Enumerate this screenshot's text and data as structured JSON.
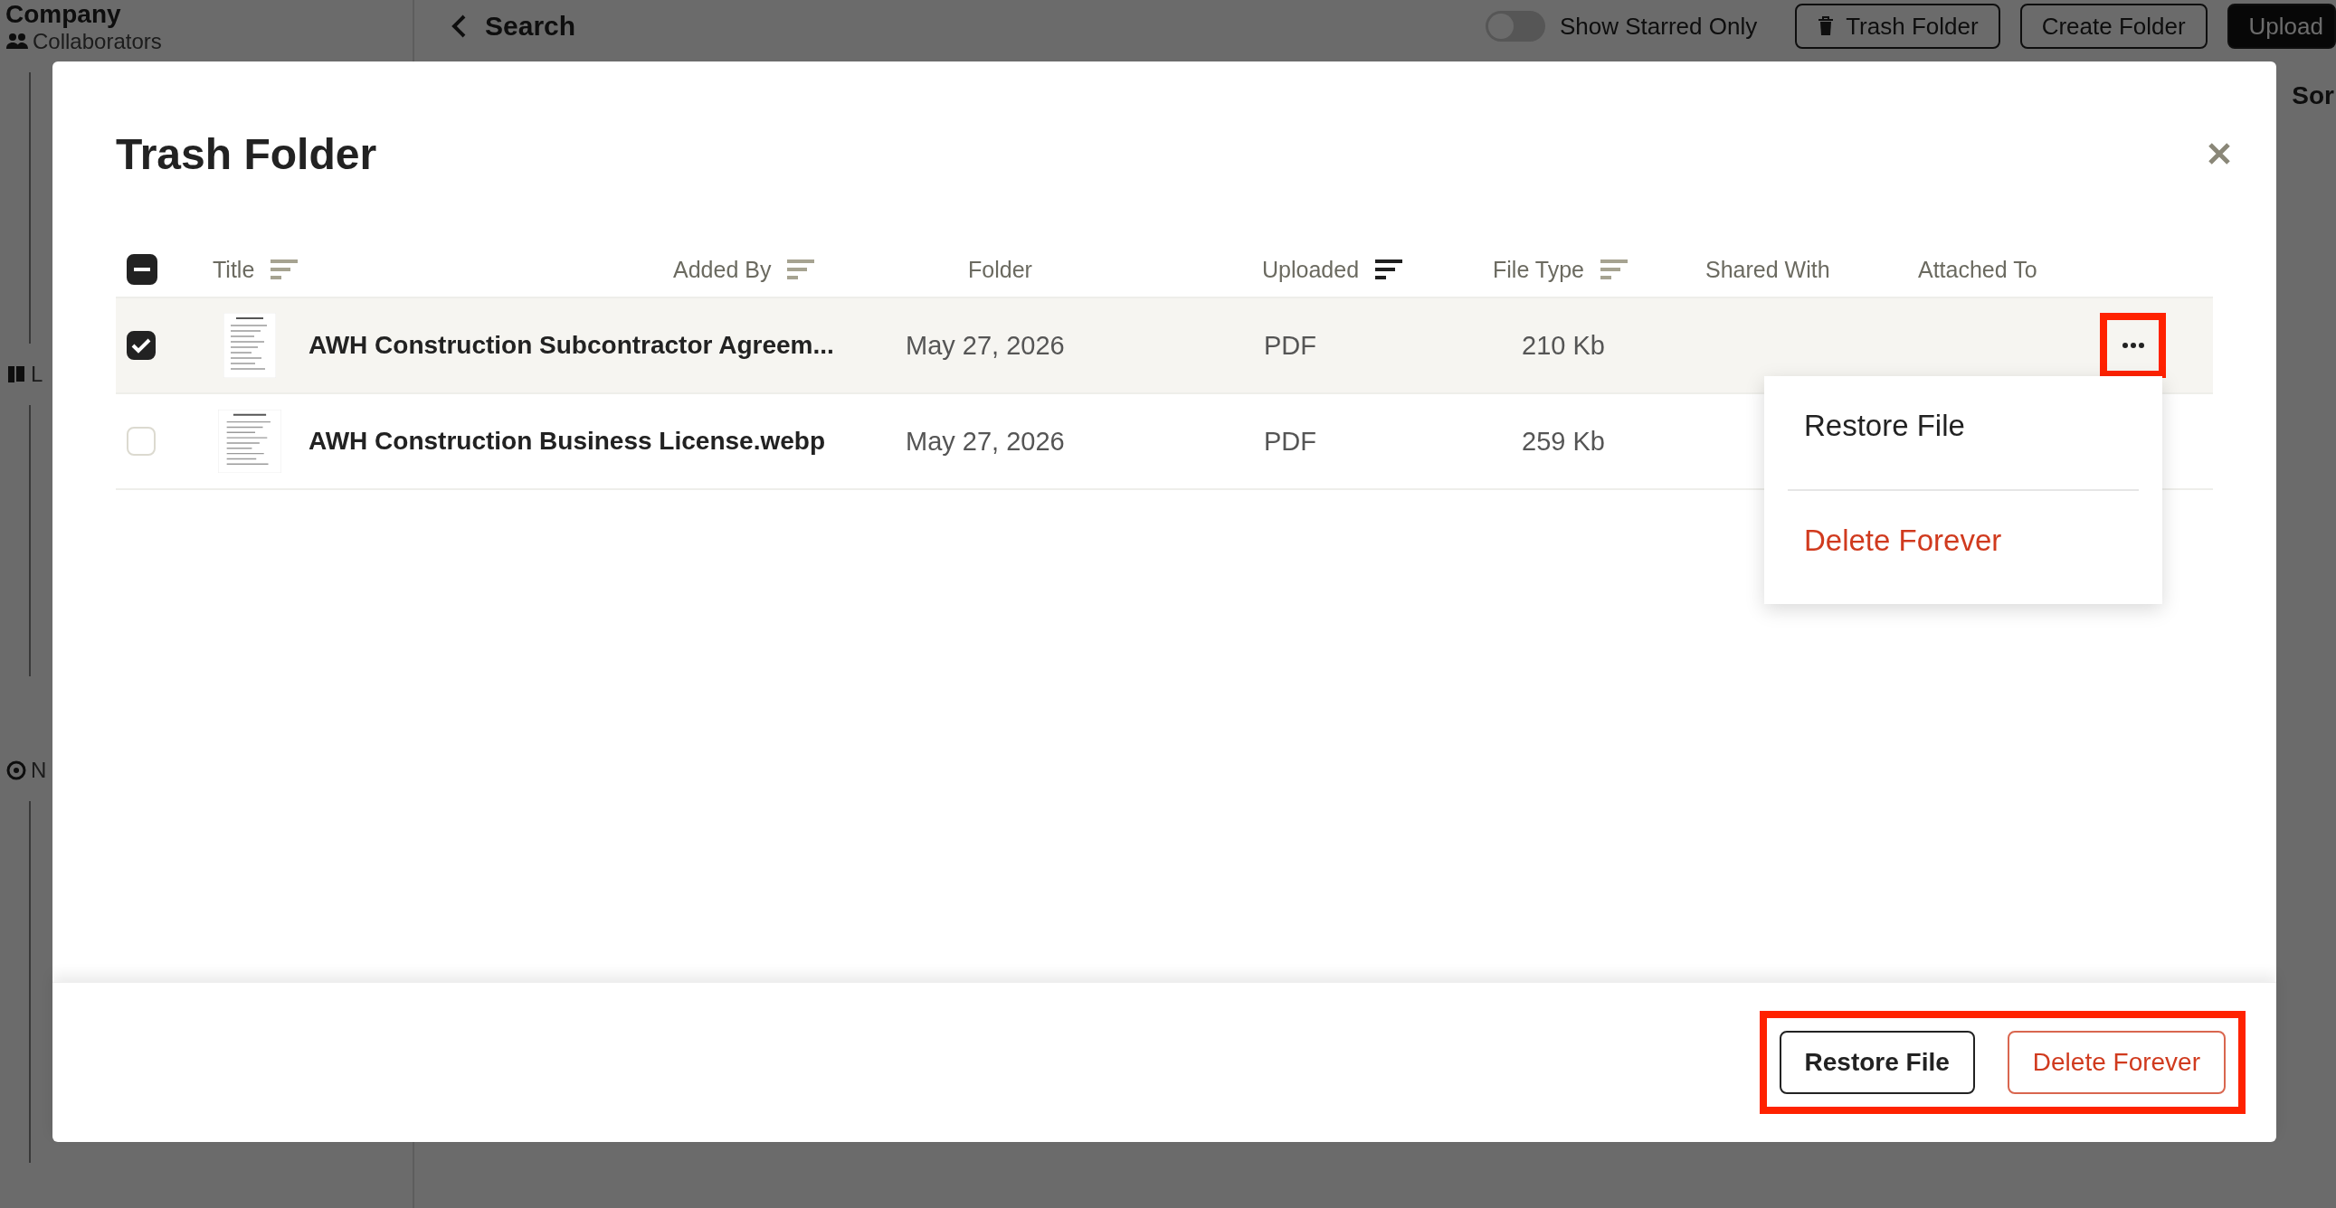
{
  "background": {
    "sidebar": {
      "heading": "Company",
      "items": [
        {
          "label": "Collaborators"
        },
        {
          "label": "L"
        },
        {
          "label": "N"
        }
      ]
    },
    "toolbar": {
      "back_label": "Search",
      "toggle": {
        "label": "Show Starred Only",
        "on": false
      },
      "buttons": [
        {
          "label": "Trash Folder",
          "kind": "outline"
        },
        {
          "label": "Create Folder",
          "kind": "outline"
        },
        {
          "label": "Upload",
          "kind": "primary"
        }
      ],
      "sort_label": "Sor"
    }
  },
  "dialog": {
    "title": "Trash Folder",
    "select_all": {
      "indeterminate": true
    },
    "columns": [
      {
        "label": "Title",
        "sortable": true,
        "active": false
      },
      {
        "label": "Added By",
        "sortable": true,
        "active": false
      },
      {
        "label": "Folder",
        "sortable": false
      },
      {
        "label": "Uploaded",
        "sortable": true,
        "active": true
      },
      {
        "label": "File Type",
        "sortable": true,
        "active": false
      },
      {
        "label": "Shared With",
        "sortable": false
      },
      {
        "label": "Attached To",
        "sortable": false
      }
    ],
    "rows": [
      {
        "selected": true,
        "title": "AWH Construction Subcontractor Agreem...",
        "date": "May 27, 2026",
        "type": "PDF",
        "size": "210 Kb",
        "actions_visible": true,
        "actions_highlighted": true
      },
      {
        "selected": false,
        "title": "AWH Construction Business License.webp",
        "date": "May 27, 2026",
        "type": "PDF",
        "size": "259 Kb"
      }
    ],
    "row_menu": {
      "items": [
        {
          "label": "Restore File",
          "kind": "normal"
        },
        {
          "label": "Delete Forever",
          "kind": "danger"
        }
      ]
    },
    "footer": {
      "highlighted": true,
      "buttons": [
        {
          "label": "Restore File",
          "kind": "outline"
        },
        {
          "label": "Delete Forever",
          "kind": "danger"
        }
      ]
    }
  }
}
